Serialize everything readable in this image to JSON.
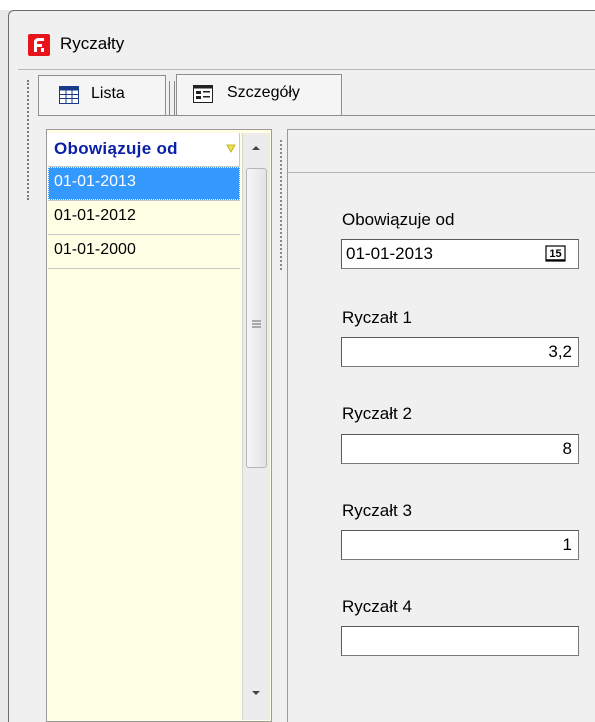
{
  "window": {
    "title": "Ryczałty",
    "app_icon": "fiscal-app-icon"
  },
  "tabs": [
    {
      "label": "Lista",
      "icon": "grid-icon",
      "active": false
    },
    {
      "label": "Szczegóły",
      "icon": "form-details-icon",
      "active": true
    }
  ],
  "list": {
    "column_header": "Obowiązuje od",
    "rows": [
      "01-01-2013",
      "01-01-2012",
      "01-01-2000"
    ],
    "selected_index": 0
  },
  "details": {
    "date_label": "Obowiązuje od",
    "date_value": "01-01-2013",
    "calendar_button_text": "15",
    "fields": [
      {
        "label": "Ryczałt 1",
        "value": "3,2"
      },
      {
        "label": "Ryczałt 2",
        "value": "8"
      },
      {
        "label": "Ryczałt 3",
        "value": "1"
      },
      {
        "label": "Ryczałt 4",
        "value": ""
      }
    ]
  },
  "colors": {
    "selection": "#3399ff",
    "list_background": "#ffffe6",
    "header_text": "#0a1fa8",
    "app_icon_red": "#e8141c"
  }
}
